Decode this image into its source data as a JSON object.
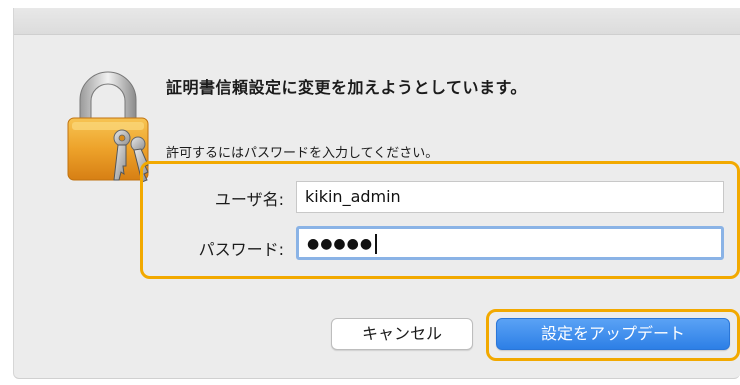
{
  "dialog": {
    "message_title": "証明書信頼設定に変更を加えようとしています。",
    "message_subtitle": "許可するにはパスワードを入力してください。"
  },
  "form": {
    "username_label": "ユーザ名:",
    "username_value": "kikin_admin",
    "password_label": "パスワード:",
    "password_masked": "●●●●●"
  },
  "buttons": {
    "cancel_label": "キャンセル",
    "update_label": "設定をアップデート"
  },
  "icons": {
    "dialog_icon": "lock-with-keys-icon"
  },
  "colors": {
    "highlight": "#f2a900",
    "primary_button": "#2d7fe6",
    "focus_ring": "#8ab3e6"
  }
}
